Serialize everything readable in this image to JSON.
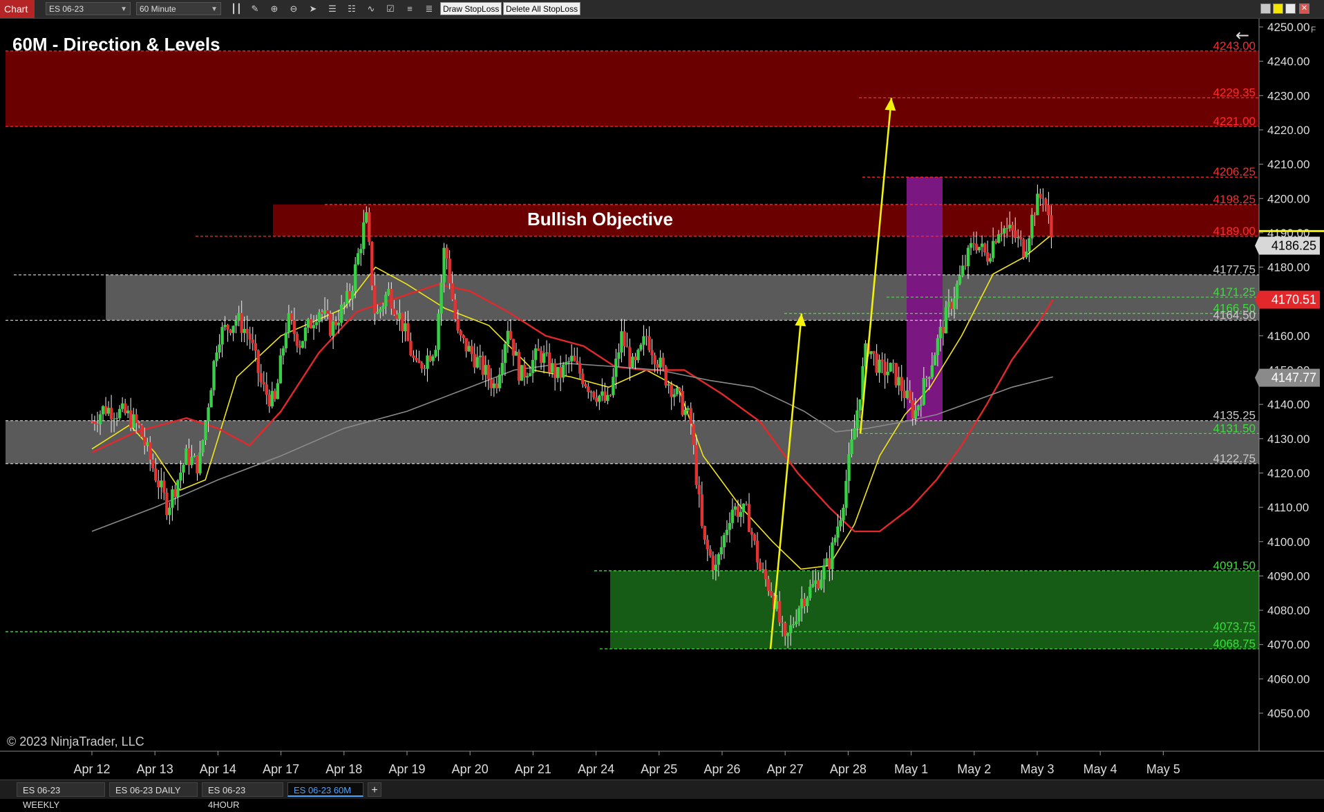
{
  "toolbar": {
    "window_label": "Chart",
    "instrument": "ES 06-23",
    "interval": "60 Minute",
    "draw_stoploss": "Draw StopLoss",
    "delete_stoploss": "Delete All StopLoss"
  },
  "chart": {
    "title": "60M - Direction & Levels",
    "annotation": "Bullish Objective",
    "copyright": "© 2023 NinjaTrader, LLC",
    "back_icon": "←",
    "corner_label": "F"
  },
  "levels": [
    {
      "label": "4243.00",
      "price": 4243.0,
      "color": "#ff2a2a"
    },
    {
      "label": "4229.35",
      "price": 4229.35,
      "color": "#ff2a2a"
    },
    {
      "label": "4221.00",
      "price": 4221.0,
      "color": "#ff2a2a"
    },
    {
      "label": "4206.25",
      "price": 4206.25,
      "color": "#ff2a2a"
    },
    {
      "label": "4198.25",
      "price": 4198.25,
      "color": "#ff2a2a"
    },
    {
      "label": "4189.00",
      "price": 4189.0,
      "color": "#ff2a2a"
    },
    {
      "label": "4177.75",
      "price": 4177.75,
      "color": "#c8c8c8"
    },
    {
      "label": "4171.25",
      "price": 4171.25,
      "color": "#3ddc3d"
    },
    {
      "label": "4166.50",
      "price": 4166.5,
      "color": "#3ddc3d"
    },
    {
      "label": "4164.50",
      "price": 4164.5,
      "color": "#c8c8c8"
    },
    {
      "label": "4135.25",
      "price": 4135.25,
      "color": "#c8c8c8"
    },
    {
      "label": "4131.50",
      "price": 4131.5,
      "color": "#3ddc3d"
    },
    {
      "label": "4122.75",
      "price": 4122.75,
      "color": "#c8c8c8"
    },
    {
      "label": "4091.50",
      "price": 4091.5,
      "color": "#3ddc3d"
    },
    {
      "label": "4073.75",
      "price": 4073.75,
      "color": "#3ddc3d"
    },
    {
      "label": "4068.75",
      "price": 4068.75,
      "color": "#3ddc3d"
    }
  ],
  "price_badges": {
    "last": "4186.25",
    "ma_red": "4170.51",
    "ma_gray": "4147.77"
  },
  "tabs": [
    "ES 06-23 WEEKLY",
    "ES 06-23 DAILY",
    "ES 06-23 4HOUR",
    "ES 06-23 60M"
  ],
  "active_tab": 3,
  "chart_data": {
    "type": "candlestick",
    "title": "60M - Direction & Levels",
    "x_categories": [
      "Apr 12",
      "Apr 13",
      "Apr 14",
      "Apr 17",
      "Apr 18",
      "Apr 19",
      "Apr 20",
      "Apr 21",
      "Apr 24",
      "Apr 25",
      "Apr 26",
      "Apr 27",
      "Apr 28",
      "May 1",
      "May 2",
      "May 3",
      "May 4",
      "May 5"
    ],
    "y_ticks": [
      4050,
      4060,
      4070,
      4080,
      4090,
      4100,
      4110,
      4120,
      4130,
      4140,
      4150,
      4160,
      4170,
      4180,
      4190,
      4200,
      4210,
      4220,
      4230,
      4240,
      4250
    ],
    "ylim": [
      4046,
      4254
    ],
    "price_path": [
      [
        0,
        4135
      ],
      [
        0.2,
        4139
      ],
      [
        0.55,
        4137
      ],
      [
        0.75,
        4133
      ],
      [
        1.0,
        4120
      ],
      [
        1.2,
        4110
      ],
      [
        1.5,
        4125
      ],
      [
        1.7,
        4122
      ],
      [
        2.0,
        4160
      ],
      [
        2.3,
        4165
      ],
      [
        2.5,
        4160
      ],
      [
        2.7,
        4145
      ],
      [
        2.9,
        4140
      ],
      [
        3.1,
        4165
      ],
      [
        3.3,
        4158
      ],
      [
        3.6,
        4168
      ],
      [
        3.8,
        4162
      ],
      [
        4.1,
        4172
      ],
      [
        4.35,
        4195
      ],
      [
        4.5,
        4165
      ],
      [
        4.7,
        4173
      ],
      [
        4.9,
        4165
      ],
      [
        5.15,
        4150
      ],
      [
        5.45,
        4157
      ],
      [
        5.6,
        4187
      ],
      [
        5.8,
        4160
      ],
      [
        6.1,
        4153
      ],
      [
        6.4,
        4145
      ],
      [
        6.6,
        4163
      ],
      [
        6.8,
        4148
      ],
      [
        7.1,
        4155
      ],
      [
        7.4,
        4148
      ],
      [
        7.6,
        4153
      ],
      [
        7.9,
        4145
      ],
      [
        8.2,
        4140
      ],
      [
        8.4,
        4160
      ],
      [
        8.6,
        4150
      ],
      [
        8.8,
        4160
      ],
      [
        9.1,
        4148
      ],
      [
        9.3,
        4142
      ],
      [
        9.5,
        4135
      ],
      [
        9.7,
        4100
      ],
      [
        9.9,
        4092
      ],
      [
        10.15,
        4110
      ],
      [
        10.4,
        4108
      ],
      [
        10.6,
        4092
      ],
      [
        10.8,
        4085
      ],
      [
        11.0,
        4070
      ],
      [
        11.25,
        4083
      ],
      [
        11.45,
        4087
      ],
      [
        11.7,
        4094
      ],
      [
        11.9,
        4110
      ],
      [
        12.1,
        4133
      ],
      [
        12.3,
        4158
      ],
      [
        12.5,
        4150
      ],
      [
        12.7,
        4150
      ],
      [
        12.9,
        4143
      ],
      [
        13.05,
        4137
      ],
      [
        13.25,
        4148
      ],
      [
        13.45,
        4160
      ],
      [
        13.6,
        4168
      ],
      [
        13.8,
        4178
      ],
      [
        14.0,
        4188
      ],
      [
        14.2,
        4183
      ],
      [
        14.4,
        4192
      ],
      [
        14.6,
        4190
      ],
      [
        14.8,
        4185
      ],
      [
        14.95,
        4197
      ],
      [
        15.1,
        4202
      ],
      [
        15.25,
        4186
      ]
    ],
    "series": [
      {
        "name": "yellow",
        "points": [
          [
            0,
            4127
          ],
          [
            0.6,
            4134
          ],
          [
            1.0,
            4126
          ],
          [
            1.4,
            4115
          ],
          [
            1.8,
            4118
          ],
          [
            2.3,
            4148
          ],
          [
            3.0,
            4160
          ],
          [
            4.0,
            4168
          ],
          [
            4.5,
            4180
          ],
          [
            5.0,
            4175
          ],
          [
            5.6,
            4168
          ],
          [
            6.3,
            4163
          ],
          [
            7.0,
            4150
          ],
          [
            7.6,
            4148
          ],
          [
            8.2,
            4145
          ],
          [
            8.8,
            4150
          ],
          [
            9.3,
            4145
          ],
          [
            9.7,
            4125
          ],
          [
            10.3,
            4110
          ],
          [
            10.8,
            4100
          ],
          [
            11.25,
            4092
          ],
          [
            11.7,
            4093
          ],
          [
            12.1,
            4105
          ],
          [
            12.5,
            4125
          ],
          [
            12.9,
            4137
          ],
          [
            13.3,
            4145
          ],
          [
            13.8,
            4160
          ],
          [
            14.3,
            4178
          ],
          [
            14.8,
            4183
          ],
          [
            15.2,
            4189
          ]
        ]
      },
      {
        "name": "red",
        "points": [
          [
            0,
            4126
          ],
          [
            0.7,
            4132
          ],
          [
            1.5,
            4136
          ],
          [
            2.0,
            4133
          ],
          [
            2.5,
            4128
          ],
          [
            3.0,
            4138
          ],
          [
            3.6,
            4155
          ],
          [
            4.2,
            4167
          ],
          [
            5.0,
            4172
          ],
          [
            5.5,
            4175
          ],
          [
            6.0,
            4173
          ],
          [
            6.6,
            4167
          ],
          [
            7.2,
            4160
          ],
          [
            7.8,
            4157
          ],
          [
            8.3,
            4151
          ],
          [
            8.8,
            4150
          ],
          [
            9.4,
            4150
          ],
          [
            10.0,
            4143
          ],
          [
            10.6,
            4135
          ],
          [
            11.2,
            4120
          ],
          [
            11.7,
            4110
          ],
          [
            12.1,
            4103
          ],
          [
            12.5,
            4103
          ],
          [
            13.0,
            4110
          ],
          [
            13.4,
            4118
          ],
          [
            13.8,
            4128
          ],
          [
            14.2,
            4140
          ],
          [
            14.6,
            4153
          ],
          [
            15.0,
            4163
          ],
          [
            15.25,
            4170.5
          ]
        ]
      },
      {
        "name": "gray",
        "points": [
          [
            0,
            4103
          ],
          [
            1.0,
            4110
          ],
          [
            2.0,
            4118
          ],
          [
            3.0,
            4125
          ],
          [
            4.0,
            4133
          ],
          [
            5.0,
            4138
          ],
          [
            6.0,
            4145
          ],
          [
            6.7,
            4150
          ],
          [
            7.5,
            4152
          ],
          [
            8.3,
            4151
          ],
          [
            9.0,
            4150
          ],
          [
            9.8,
            4147
          ],
          [
            10.5,
            4145
          ],
          [
            11.3,
            4138
          ],
          [
            11.8,
            4132
          ],
          [
            12.3,
            4133
          ],
          [
            12.9,
            4135
          ],
          [
            13.4,
            4137
          ],
          [
            14.0,
            4141
          ],
          [
            14.6,
            4145
          ],
          [
            15.25,
            4148
          ]
        ]
      }
    ]
  }
}
